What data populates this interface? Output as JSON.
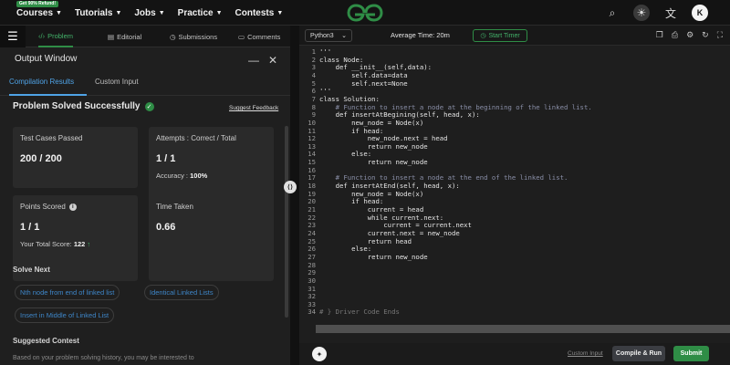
{
  "nav": {
    "promo": "Get 90% Refund!",
    "menu": [
      {
        "label": "Courses"
      },
      {
        "label": "Tutorials"
      },
      {
        "label": "Jobs"
      },
      {
        "label": "Practice"
      },
      {
        "label": "Contests"
      }
    ],
    "avatar_initial": "K"
  },
  "problem_tabs": {
    "problem": "Problem",
    "editorial": "Editorial",
    "submissions": "Submissions",
    "comments": "Comments"
  },
  "output_window": {
    "title": "Output Window",
    "tabs": {
      "compilation": "Compilation Results",
      "custom_input": "Custom Input"
    },
    "status": "Problem Solved Successfully",
    "feedback_link": "Suggest Feedback",
    "cards": {
      "test_cases": {
        "label": "Test Cases Passed",
        "value": "200 / 200"
      },
      "attempts": {
        "label": "Attempts : Correct / Total",
        "value": "1 / 1",
        "sub_label": "Accuracy :",
        "sub_value": "100%"
      },
      "points": {
        "label": "Points Scored",
        "value": "1 / 1",
        "sub_label": "Your Total Score:",
        "sub_value": "122"
      },
      "time": {
        "label": "Time Taken",
        "value": "0.66"
      }
    },
    "solve_next_title": "Solve Next",
    "solve_next": [
      "Nth node from end of linked list",
      "Identical Linked Lists",
      "Insert in Middle of Linked List"
    ],
    "suggested_contest_title": "Suggested Contest",
    "cutoff_text": "Based on your problem solving history, you may be interested to"
  },
  "editor": {
    "language": "Python3",
    "average_time": "Average Time: 20m",
    "timer_label": "Start Timer",
    "lines": [
      "'''",
      "class Node:",
      "    def __init__(self,data):",
      "        self.data=data",
      "        self.next=None",
      "'''",
      "class Solution:",
      "    # Function to insert a node at the beginning of the linked list.",
      "    def insertAtBegining(self, head, x):",
      "        new_node = Node(x)",
      "        if head:",
      "            new_node.next = head",
      "            return new_node",
      "        else:",
      "            return new_node",
      "",
      "    # Function to insert a node at the end of the linked list.",
      "    def insertAtEnd(self, head, x):",
      "        new_node = Node(x)",
      "        if head:",
      "            current = head",
      "            while current.next:",
      "                current = current.next",
      "            current.next = new_node",
      "            return head",
      "        else:",
      "            return new_node",
      "",
      "",
      "",
      "",
      "",
      "",
      "# } Driver Code Ends"
    ],
    "custom_input": "Custom Input",
    "compile_run": "Compile & Run",
    "submit": "Submit"
  },
  "colors": {
    "brand_green": "#2f8d46",
    "link_blue": "#4fa3e6",
    "chip_blue": "#3e86c8"
  }
}
